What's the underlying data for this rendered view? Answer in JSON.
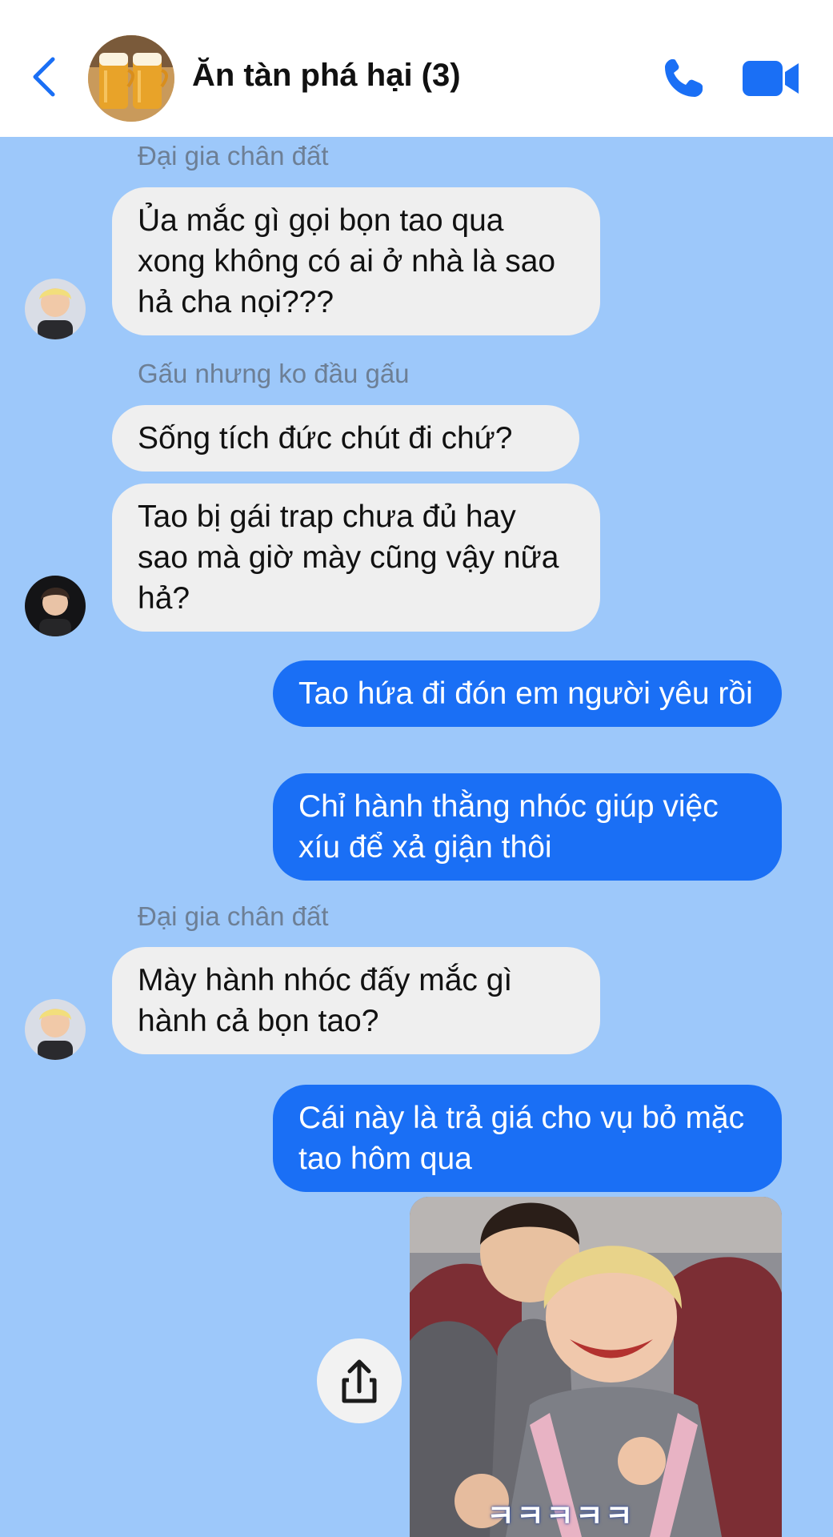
{
  "header": {
    "title": "Ăn tàn phá hại (3)",
    "back_icon": "chevron-left-icon",
    "call_icon": "phone-icon",
    "video_icon": "video-camera-icon"
  },
  "colors": {
    "background": "#9dc8fa",
    "header_background": "#ffffff",
    "accent_blue": "#1a6ff5",
    "incoming_bubble": "#efefef",
    "outgoing_bubble": "#1a6ff5",
    "sender_name": "#6d7f95"
  },
  "messages": [
    {
      "sender": "Đại gia chân đất",
      "direction": "incoming",
      "bubbles": [
        "Ủa mắc gì gọi bọn tao qua xong không có ai ở nhà là sao hả cha nọi???"
      ]
    },
    {
      "sender": "Gấu nhưng ko đầu gấu",
      "direction": "incoming",
      "bubbles": [
        "Sống tích đức chút đi chứ?",
        "Tao bị gái trap chưa đủ hay sao mà giờ mày cũng vậy nữa hả?"
      ]
    },
    {
      "sender": "",
      "direction": "outgoing",
      "bubbles": [
        "Tao hứa đi đón em người yêu rồi",
        "Chỉ hành thằng nhóc giúp việc xíu để xả giận thôi"
      ]
    },
    {
      "sender": "Đại gia chân đất",
      "direction": "incoming",
      "bubbles": [
        "Mày hành nhóc đấy mắc gì hành cả bọn tao?"
      ]
    },
    {
      "sender": "",
      "direction": "outgoing",
      "bubbles": [
        "Cái này là trả giá cho vụ bỏ mặc tao hôm qua"
      ]
    }
  ],
  "photo": {
    "caption_overlay": "ㅋㅋㅋㅋㅋ",
    "share_icon": "share-icon"
  }
}
